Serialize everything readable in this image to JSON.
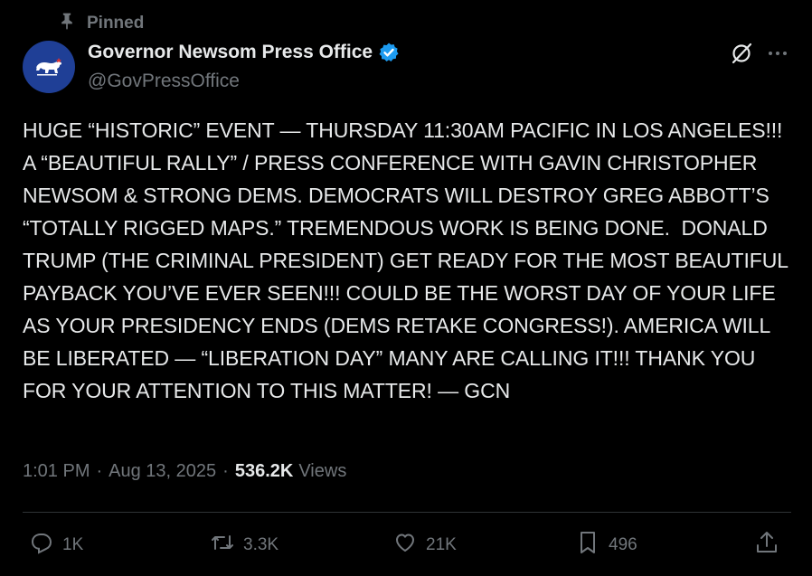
{
  "pinned": {
    "label": "Pinned",
    "icon": "pin-icon"
  },
  "author": {
    "display_name": "Governor Newsom Press Office",
    "handle": "@GovPressOffice",
    "verified": true,
    "avatar_color": "#1f3f96",
    "verified_color": "#1d9bf0"
  },
  "tweet": {
    "text": "HUGE “HISTORIC” EVENT — THURSDAY 11:30AM PACIFIC IN LOS ANGELES!!!  A “BEAUTIFUL RALLY” / PRESS CONFERENCE WITH GAVIN CHRISTOPHER NEWSOM & STRONG DEMS. DEMOCRATS WILL DESTROY GREG ABBOTT’S “TOTALLY RIGGED MAPS.” TREMENDOUS WORK IS BEING DONE.  DONALD TRUMP (THE CRIMINAL PRESIDENT) GET READY FOR THE MOST BEAUTIFUL PAYBACK YOU’VE EVER SEEN!!! COULD BE THE WORST DAY OF YOUR LIFE AS YOUR PRESIDENCY ENDS (DEMS RETAKE CONGRESS!). AMERICA WILL BE LIBERATED — “LIBERATION DAY” MANY ARE CALLING IT!!! THANK YOU FOR YOUR ATTENTION TO THIS MATTER! — GCN"
  },
  "meta": {
    "time": "1:01 PM",
    "separator": "·",
    "date": "Aug 13, 2025",
    "views_count": "536.2K",
    "views_label": "Views"
  },
  "actions": {
    "reply_count": "1K",
    "repost_count": "3.3K",
    "like_count": "21K",
    "bookmark_count": "496"
  },
  "colors": {
    "background": "#000000",
    "text_primary": "#e7e9ea",
    "text_secondary": "#71767b",
    "divider": "#2f3336"
  }
}
